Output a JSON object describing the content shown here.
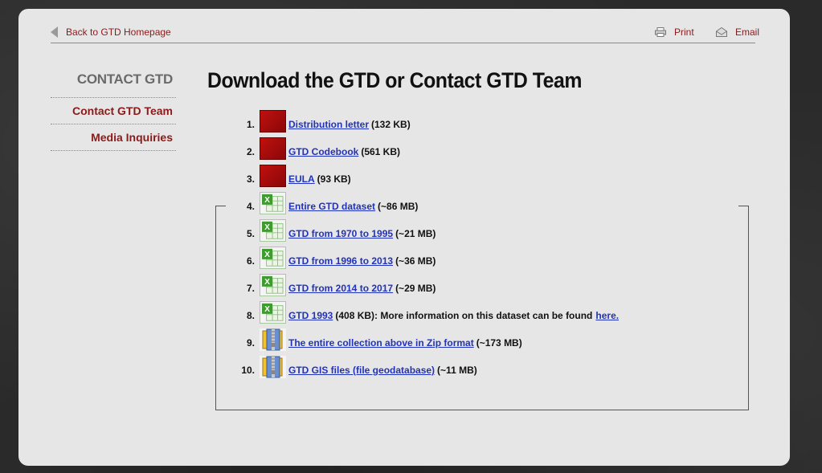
{
  "topbar": {
    "back_label": "Back to GTD Homepage",
    "print_label": "Print",
    "email_label": "Email"
  },
  "sidebar": {
    "title": "CONTACT GTD",
    "items": [
      {
        "label": "Contact GTD Team"
      },
      {
        "label": "Media Inquiries"
      }
    ]
  },
  "main": {
    "title": "Download the GTD or Contact GTD Team",
    "files": [
      {
        "num": "1.",
        "icon": "pdf-icon",
        "link": "Distribution letter",
        "size": "(132 KB)"
      },
      {
        "num": "2.",
        "icon": "pdf-icon",
        "link": "GTD Codebook",
        "size": "(561 KB)"
      },
      {
        "num": "3.",
        "icon": "pdf-icon",
        "link": "EULA",
        "size": "(93 KB)"
      },
      {
        "num": "4.",
        "icon": "excel-icon",
        "link": "Entire GTD dataset",
        "size": "(~86 MB)"
      },
      {
        "num": "5.",
        "icon": "excel-icon",
        "link": "GTD from 1970 to 1995",
        "size": "(~21 MB)"
      },
      {
        "num": "6.",
        "icon": "excel-icon",
        "link": "GTD from 1996 to 2013",
        "size": "(~36 MB)"
      },
      {
        "num": "7.",
        "icon": "excel-icon",
        "link": "GTD from 2014 to 2017",
        "size": "(~29 MB)"
      },
      {
        "num": "8.",
        "icon": "excel-icon",
        "link": "GTD 1993",
        "size": "(408 KB): More information on this dataset can be found",
        "more": "here."
      },
      {
        "num": "9.",
        "icon": "zip-icon",
        "link": "The entire collection above in Zip format",
        "size": "(~173 MB)"
      },
      {
        "num": "10.",
        "icon": "zip-icon",
        "link": "GTD GIS files (file geodatabase)",
        "size": "(~11 MB)"
      }
    ]
  },
  "colors": {
    "accent": "#8b1a1a",
    "link": "#2233bb",
    "panel": "#e6e6e6"
  }
}
